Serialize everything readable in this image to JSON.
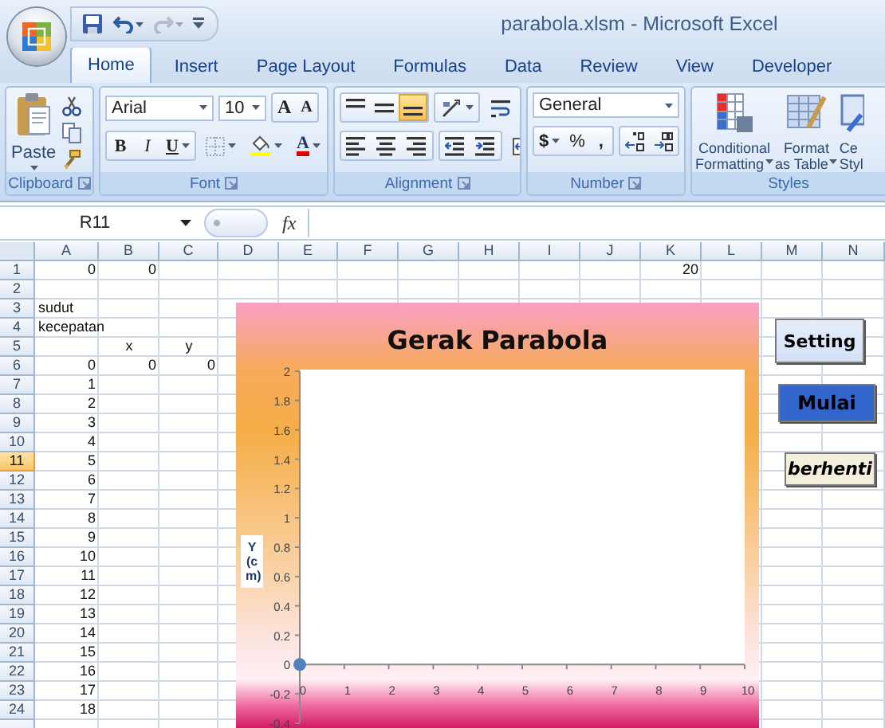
{
  "window": {
    "title": "parabola.xlsm - Microsoft Excel"
  },
  "quick_access": [
    {
      "kind": "save",
      "disabled": false
    },
    {
      "kind": "undo",
      "disabled": false
    },
    {
      "kind": "redo",
      "disabled": true
    },
    {
      "kind": "customize",
      "disabled": false
    }
  ],
  "tabs": [
    {
      "label": "Home",
      "selected": true
    },
    {
      "label": "Insert",
      "selected": false
    },
    {
      "label": "Page Layout",
      "selected": false
    },
    {
      "label": "Formulas",
      "selected": false
    },
    {
      "label": "Data",
      "selected": false
    },
    {
      "label": "Review",
      "selected": false
    },
    {
      "label": "View",
      "selected": false
    },
    {
      "label": "Developer",
      "selected": false
    }
  ],
  "ribbon": {
    "clipboard": {
      "label": "Clipboard",
      "launcher": true,
      "paste": "Paste"
    },
    "font": {
      "label": "Font",
      "launcher": true,
      "font_name": "Arial",
      "font_size": "10",
      "grow": "A",
      "shrink": "A",
      "bold": "B",
      "italic": "I",
      "underline": "U",
      "font_color": "A"
    },
    "alignment": {
      "label": "Alignment",
      "launcher": true,
      "rows": [
        [
          {
            "kind": "align-top",
            "selected": false
          },
          {
            "kind": "align-middle",
            "selected": false
          },
          {
            "kind": "align-bottom",
            "selected": true
          },
          {
            "kind": "orientation",
            "selected": false
          },
          {
            "kind": "wrap",
            "selected": false
          }
        ],
        [
          {
            "kind": "align-left",
            "selected": false
          },
          {
            "kind": "align-center",
            "selected": false
          },
          {
            "kind": "align-right",
            "selected": false
          },
          {
            "kind": "indent-decrease",
            "selected": false
          },
          {
            "kind": "indent-increase",
            "selected": false
          },
          {
            "kind": "merge",
            "selected": false
          }
        ]
      ]
    },
    "number": {
      "label": "Number",
      "launcher": true,
      "format": "General",
      "currency": "$",
      "percent": "%",
      "comma": ","
    },
    "styles": {
      "label": "Styles",
      "launcher": false,
      "buttons": [
        {
          "kind": "conditional",
          "lines": [
            "Conditional",
            "Formatting"
          ],
          "dropdown": true
        },
        {
          "kind": "table",
          "lines": [
            "Format",
            "as Table"
          ],
          "dropdown": true
        },
        {
          "kind": "cell-styles",
          "lines": [
            "Ce",
            "Styl"
          ],
          "dropdown": false
        }
      ]
    }
  },
  "formula_bar": {
    "name_box": "R11",
    "function_label": "fx"
  },
  "sheet": {
    "columns": [
      {
        "label": "A",
        "selected": false
      },
      {
        "label": "B",
        "selected": false
      },
      {
        "label": "C",
        "selected": false
      },
      {
        "label": "D",
        "selected": false
      },
      {
        "label": "E",
        "selected": false
      },
      {
        "label": "F",
        "selected": false
      },
      {
        "label": "G",
        "selected": false
      },
      {
        "label": "H",
        "selected": false
      },
      {
        "label": "I",
        "selected": false
      },
      {
        "label": "J",
        "selected": false
      },
      {
        "label": "K",
        "selected": false
      },
      {
        "label": "L",
        "selected": false
      },
      {
        "label": "M",
        "selected": false
      },
      {
        "label": "N",
        "selected": false
      }
    ],
    "rows": [
      {
        "header": "1",
        "selected": false,
        "cells": [
          {
            "value": "0",
            "kind": "number"
          },
          {
            "value": "0",
            "kind": "number"
          },
          null,
          null,
          null,
          null,
          null,
          null,
          null,
          null,
          {
            "value": "20",
            "kind": "number"
          }
        ]
      },
      {
        "header": "2",
        "selected": false,
        "cells": []
      },
      {
        "header": "3",
        "selected": false,
        "cells": [
          {
            "value": "sudut",
            "kind": "text"
          }
        ]
      },
      {
        "header": "4",
        "selected": false,
        "cells": [
          {
            "value": "kecepatan",
            "kind": "text"
          }
        ]
      },
      {
        "header": "5",
        "selected": false,
        "cells": [
          null,
          {
            "value": "x",
            "kind": "heading"
          },
          {
            "value": "y",
            "kind": "heading"
          }
        ]
      },
      {
        "header": "6",
        "selected": false,
        "cells": [
          {
            "value": "0",
            "kind": "number"
          },
          {
            "value": "0",
            "kind": "number"
          },
          {
            "value": "0",
            "kind": "number"
          }
        ]
      },
      {
        "header": "7",
        "selected": false,
        "cells": [
          {
            "value": "1",
            "kind": "number"
          }
        ]
      },
      {
        "header": "8",
        "selected": false,
        "cells": [
          {
            "value": "2",
            "kind": "number"
          }
        ]
      },
      {
        "header": "9",
        "selected": false,
        "cells": [
          {
            "value": "3",
            "kind": "number"
          }
        ]
      },
      {
        "header": "10",
        "selected": false,
        "cells": [
          {
            "value": "4",
            "kind": "number"
          }
        ]
      },
      {
        "header": "11",
        "selected": true,
        "cells": [
          {
            "value": "5",
            "kind": "number"
          }
        ]
      },
      {
        "header": "12",
        "selected": false,
        "cells": [
          {
            "value": "6",
            "kind": "number"
          }
        ]
      },
      {
        "header": "13",
        "selected": false,
        "cells": [
          {
            "value": "7",
            "kind": "number"
          }
        ]
      },
      {
        "header": "14",
        "selected": false,
        "cells": [
          {
            "value": "8",
            "kind": "number"
          }
        ]
      },
      {
        "header": "15",
        "selected": false,
        "cells": [
          {
            "value": "9",
            "kind": "number"
          }
        ]
      },
      {
        "header": "16",
        "selected": false,
        "cells": [
          {
            "value": "10",
            "kind": "number"
          }
        ]
      },
      {
        "header": "17",
        "selected": false,
        "cells": [
          {
            "value": "11",
            "kind": "number"
          }
        ]
      },
      {
        "header": "18",
        "selected": false,
        "cells": [
          {
            "value": "12",
            "kind": "number"
          }
        ]
      },
      {
        "header": "19",
        "selected": false,
        "cells": [
          {
            "value": "13",
            "kind": "number"
          }
        ]
      },
      {
        "header": "20",
        "selected": false,
        "cells": [
          {
            "value": "14",
            "kind": "number"
          }
        ]
      },
      {
        "header": "21",
        "selected": false,
        "cells": [
          {
            "value": "15",
            "kind": "number"
          }
        ]
      },
      {
        "header": "22",
        "selected": false,
        "cells": [
          {
            "value": "16",
            "kind": "number"
          }
        ]
      },
      {
        "header": "23",
        "selected": false,
        "cells": [
          {
            "value": "17",
            "kind": "number"
          }
        ]
      },
      {
        "header": "24",
        "selected": false,
        "cells": [
          {
            "value": "18",
            "kind": "number"
          }
        ]
      }
    ]
  },
  "chart": {
    "chart_data": {
      "type": "scatter",
      "title": "Gerak Parabola",
      "ylabel": "Y (cm)",
      "x": [
        0
      ],
      "series": [
        {
          "color": "#4f81bd",
          "values": [
            0
          ]
        }
      ],
      "xlim": [
        0,
        10
      ],
      "ylim": [
        -0.4,
        2
      ],
      "xticks": [
        0,
        1,
        2,
        3,
        4,
        5,
        6,
        7,
        8,
        9,
        10
      ],
      "yticks": [
        -0.4,
        -0.2,
        0,
        0.2,
        0.4,
        0.6,
        0.8,
        1,
        1.2,
        1.4,
        1.6,
        1.8,
        2
      ]
    }
  },
  "macro_buttons": [
    {
      "label": "Setting",
      "kind": "light"
    },
    {
      "label": "Mulai",
      "kind": "blue"
    },
    {
      "label": "berhenti",
      "kind": "cream"
    }
  ]
}
